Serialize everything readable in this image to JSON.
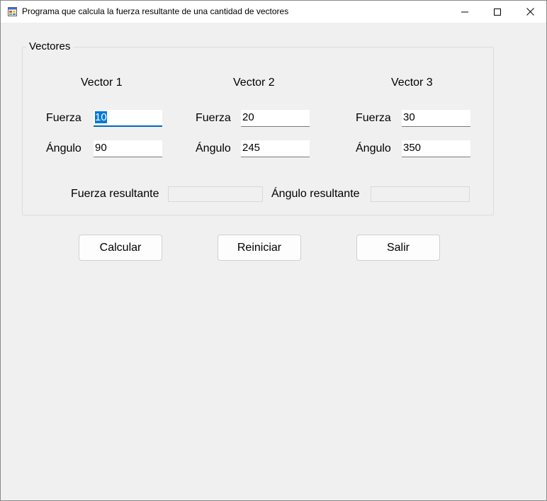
{
  "window": {
    "title": "Programa que calcula la fuerza resultante de una cantidad de vectores"
  },
  "group": {
    "title": "Vectores",
    "vectors": [
      {
        "header": "Vector 1",
        "force_label": "Fuerza",
        "force_value": "10",
        "angle_label": "Ángulo",
        "angle_value": "90"
      },
      {
        "header": "Vector 2",
        "force_label": "Fuerza",
        "force_value": "20",
        "angle_label": "Ángulo",
        "angle_value": "245"
      },
      {
        "header": "Vector 3",
        "force_label": "Fuerza",
        "force_value": "30",
        "angle_label": "Ángulo",
        "angle_value": "350"
      }
    ],
    "result_force_label": "Fuerza resultante",
    "result_force_value": "",
    "result_angle_label": "Ángulo resultante",
    "result_angle_value": ""
  },
  "buttons": {
    "calcular": "Calcular",
    "reiniciar": "Reiniciar",
    "salir": "Salir"
  },
  "icons": {
    "app": "form-app-icon",
    "minimize": "minimize-icon",
    "maximize": "maximize-icon",
    "close": "close-icon"
  }
}
